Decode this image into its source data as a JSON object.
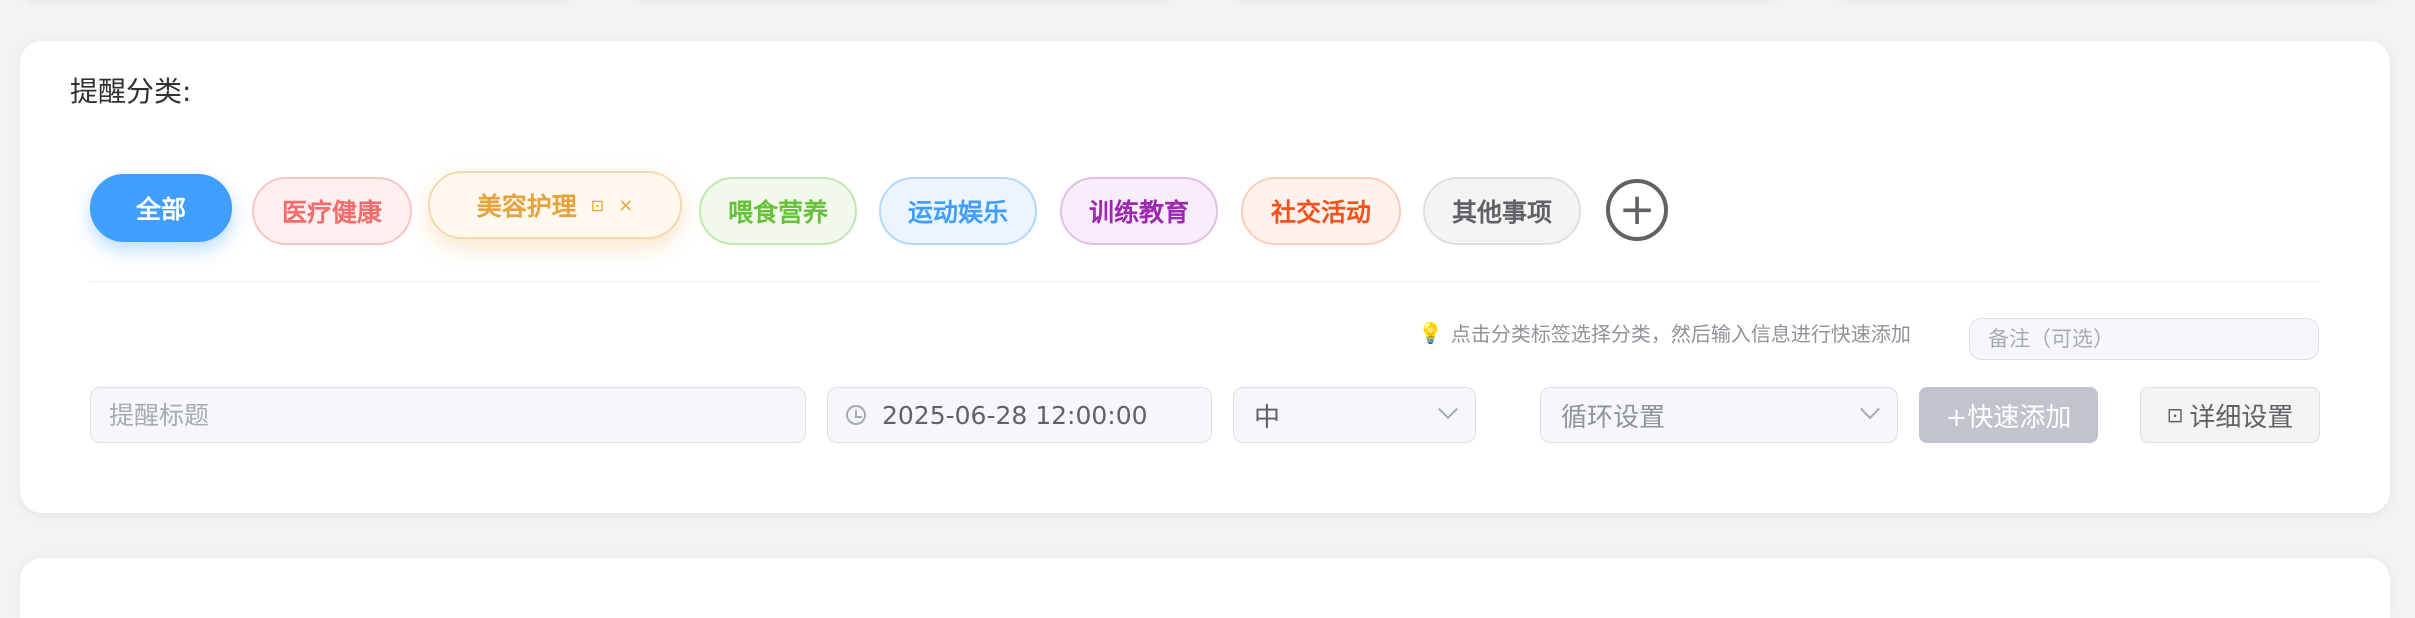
{
  "section": {
    "label": "提醒分类:"
  },
  "categories": [
    {
      "label": "全部",
      "color": "#ffffff",
      "bg": "#409eff",
      "border": "#409eff"
    },
    {
      "label": "医疗健康",
      "color": "#f56c6c",
      "bg": "#fff0f0",
      "border": "#fbc4c4"
    },
    {
      "label": "美容护理",
      "color": "#e6a23c",
      "bg": "#fff8ee",
      "border": "#f5dab1",
      "active": true
    },
    {
      "label": "喂食营养",
      "color": "#67c23a",
      "bg": "#f0f9eb",
      "border": "#c2e7b0"
    },
    {
      "label": "运动娱乐",
      "color": "#409eff",
      "bg": "#ecf5ff",
      "border": "#b3d8ff"
    },
    {
      "label": "训练教育",
      "color": "#9c27b0",
      "bg": "#f9ecfb",
      "border": "#e1bee7"
    },
    {
      "label": "社交活动",
      "color": "#f4511e",
      "bg": "#fff1ec",
      "border": "#ffccbc"
    },
    {
      "label": "其他事项",
      "color": "#606266",
      "bg": "#f4f4f5",
      "border": "#dcdfe6"
    }
  ],
  "tag_actions": {
    "edit_icon": "⊡",
    "close_icon": "×"
  },
  "add_category": {
    "icon": "plus-circle-icon",
    "symbol": "+"
  },
  "hint": {
    "icon": "lightbulb-icon",
    "text": "点击分类标签选择分类，然后输入信息进行快速添加"
  },
  "form": {
    "note_placeholder": "备注（可选）",
    "title_placeholder": "提醒标题",
    "datetime_value": "2025-06-28 12:00:00",
    "priority_value": "中",
    "repeat_placeholder": "循环设置",
    "quick_add_label": "+快速添加",
    "detail_label": "详细设置"
  }
}
